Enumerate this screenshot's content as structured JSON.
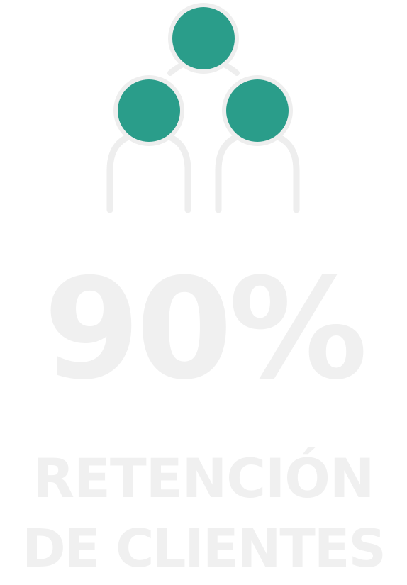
{
  "icon": {
    "name": "customers-group-icon",
    "accent_color": "#2a9d8a",
    "line_color": "#eeeeee"
  },
  "stat": {
    "value": "90%",
    "label_line_1": "RETENCIÓN",
    "label_line_2": "DE CLIENTES",
    "text_color": "#f0f0f0"
  }
}
